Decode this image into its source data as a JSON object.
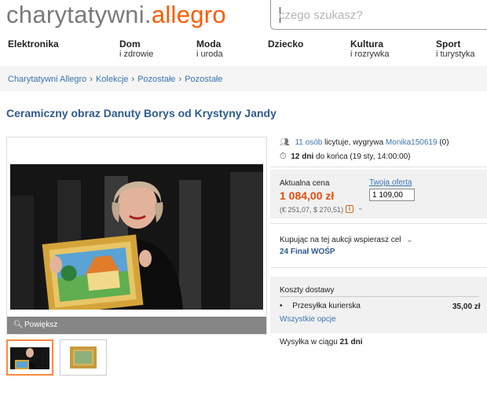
{
  "logo": {
    "part1": "charytatywni.",
    "part2": "allegro"
  },
  "search": {
    "placeholder": "czego szukasz?"
  },
  "nav": [
    {
      "line1": "Elektronika",
      "line2": ""
    },
    {
      "line1": "Dom",
      "line2": "i zdrowie"
    },
    {
      "line1": "Moda",
      "line2": "i uroda"
    },
    {
      "line1": "Dziecko",
      "line2": ""
    },
    {
      "line1": "Kultura",
      "line2": "i rozrywka"
    },
    {
      "line1": "Sport",
      "line2": "i turystyka"
    }
  ],
  "breadcrumb": [
    "Charytatywni Allegro",
    "Kolekcje",
    "Pozostałe",
    "Pozostałe"
  ],
  "breadcrumb_sep": "›",
  "title": "Ceramiczny obraz Danuty Borys od Krystyny Jandy",
  "gallery": {
    "zoom_label": "Powiększ"
  },
  "auction": {
    "bidders": "11 osób",
    "bid_text": "licytuje, wygrywa",
    "winner": "Monika150619",
    "winner_score": "(0)",
    "days": "12 dni",
    "ends_text": "do końca (19 sty, 14:00:00)"
  },
  "price": {
    "label": "Aktualna cena",
    "value": "1 084,00 zł",
    "converted": "(€ 251,07, $ 270,51)",
    "offer_label": "Twoja oferta",
    "offer_value": "1 109,00"
  },
  "charity": {
    "text": "Kupując na tej aukcji wspierasz cel",
    "name": "24 Finał WOŚP"
  },
  "shipping": {
    "header": "Koszty dostawy",
    "method": "Przesyłka kurierska",
    "cost": "35,00 zł",
    "all_options": "Wszystkie opcje",
    "dispatch_prefix": "Wysyłka w ciągu",
    "dispatch_days": "21 dni"
  },
  "colors": {
    "accent": "#ff5a00",
    "link": "#3a74b5",
    "title": "#2e5b8f",
    "price": "#e84c0c"
  }
}
